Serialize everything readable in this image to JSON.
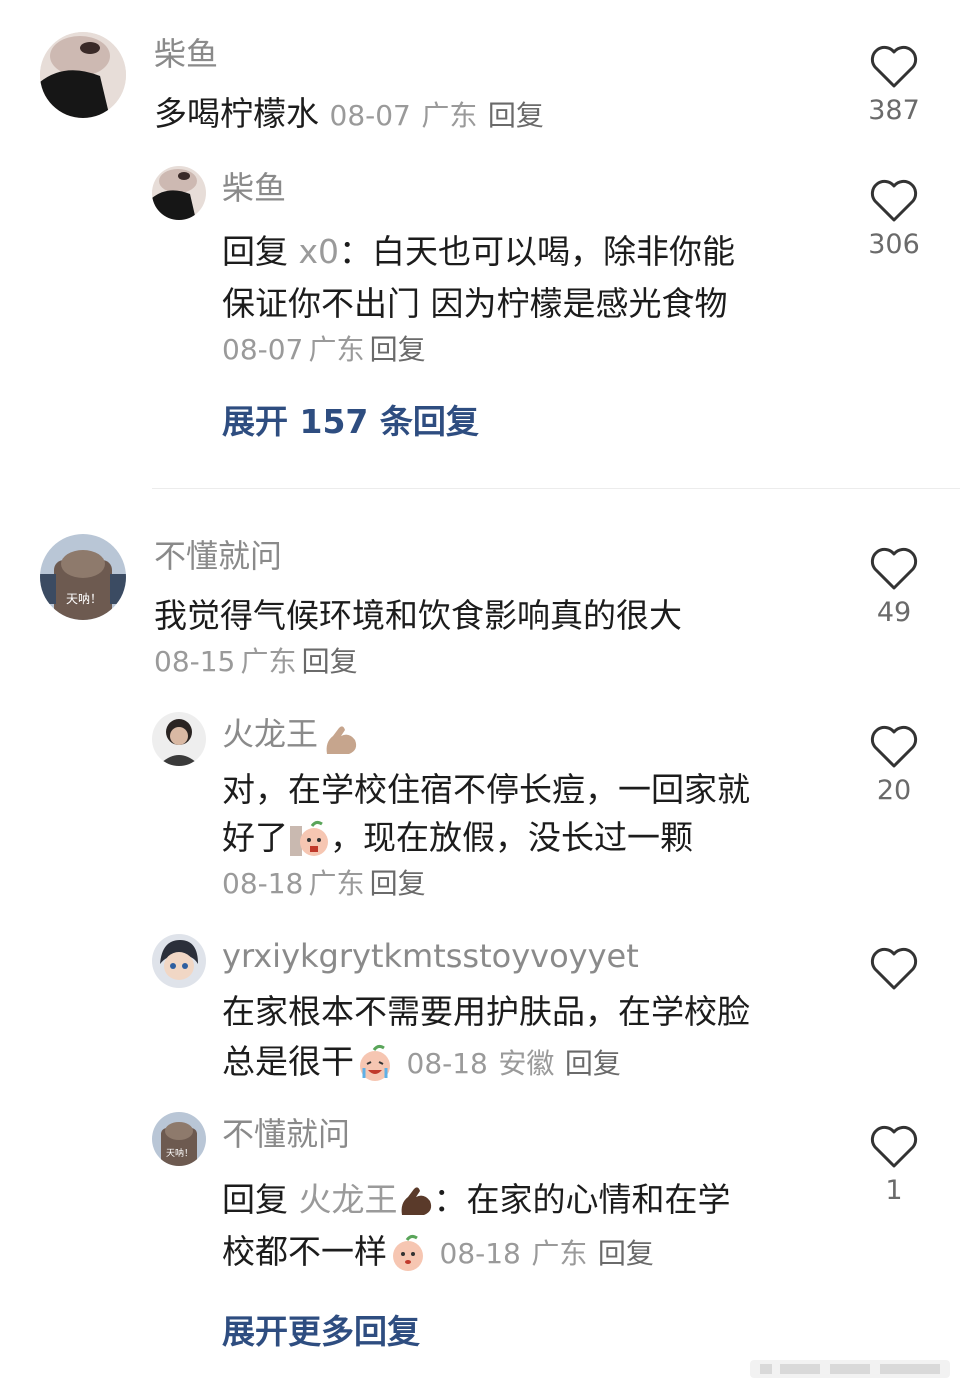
{
  "comments": [
    {
      "user": "柴鱼",
      "text": "多喝柠檬水",
      "date": "08-07",
      "location": "广东",
      "reply_label": "回复",
      "likes": "387",
      "replies": [
        {
          "user": "柴鱼",
          "reply_prefix": "回复",
          "reply_to": "x0",
          "separator": "：",
          "text_line1": "白天也可以喝，除非你能",
          "text_line2": "保证你不出门 因为柠檬是感光食物",
          "date": "08-07",
          "location": "广东",
          "reply_label": "回复",
          "likes": "306"
        }
      ],
      "expand_label": "展开 157 条回复"
    },
    {
      "user": "不懂就问",
      "avatar_caption": "天呐！",
      "text": "我觉得气候环境和饮食影响真的很大",
      "date": "08-15",
      "location": "广东",
      "reply_label": "回复",
      "likes": "49",
      "replies": [
        {
          "user": "火龙王",
          "text_line1": "对，在学校住宿不停长痘，一回家就",
          "text_line2a": "好了",
          "text_line2b": "，现在放假，没长过一颗",
          "date": "08-18",
          "location": "广东",
          "reply_label": "回复",
          "likes": "20"
        },
        {
          "user": "yrxiykgrytkmtsstoyvoyyet",
          "text_line1": "在家根本不需要用护肤品，在学校脸",
          "text_line2": "总是很干",
          "date": "08-18",
          "location": "安徽",
          "reply_label": "回复",
          "likes": ""
        },
        {
          "user": "不懂就问",
          "avatar_caption": "天呐！",
          "reply_prefix": "回复",
          "reply_to": "火龙王",
          "separator": "：",
          "text_line1": "在家的心情和在学",
          "text_line2": "校都不一样",
          "date": "08-18",
          "location": "广东",
          "reply_label": "回复",
          "likes": "1"
        }
      ],
      "expand_label": "展开更多回复"
    }
  ],
  "icons": {
    "like": "heart-outline-icon",
    "flex": "flexed-biceps-icon",
    "peach": "peach-face-emoji"
  },
  "colors": {
    "accent_link": "#2e4d80",
    "muted_text": "#8a8a8a",
    "heart_stroke": "#333333"
  }
}
